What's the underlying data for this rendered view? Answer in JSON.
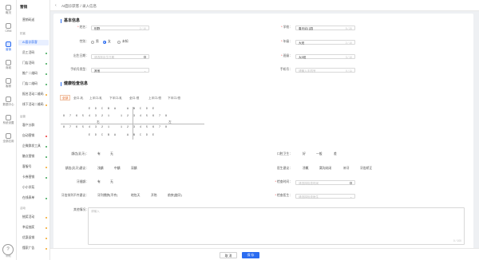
{
  "rail": [
    {
      "label": "概况",
      "icon": "dashboard-icon"
    },
    {
      "label": "CRM",
      "icon": "user-icon"
    },
    {
      "label": "营销",
      "icon": "flower-icon"
    },
    {
      "label": "商城",
      "icon": "store-icon"
    },
    {
      "label": "客服",
      "icon": "headset-icon"
    },
    {
      "label": "数据中心",
      "icon": "data-icon"
    },
    {
      "label": "系统设置",
      "icon": "gear-icon"
    },
    {
      "label": "全部应用",
      "icon": "grid-icon"
    }
  ],
  "help_label": "帮助",
  "menu": {
    "title": "营销",
    "item_top": "营销码送",
    "group_tuoke": "拓客",
    "tuoke_items": [
      {
        "label": "AI面诊获客",
        "dot": ""
      },
      {
        "label": "员工活码",
        "dot": "#3aa655"
      },
      {
        "label": "门店活码",
        "dot": "#3aa655"
      },
      {
        "label": "推广二维码",
        "dot": "#3aa655"
      },
      {
        "label": "门店二维码",
        "dot": "#3aa655"
      },
      {
        "label": "报名活动二维码",
        "dot": "#f5a623"
      },
      {
        "label": "线下活动二维码",
        "dot": "#f5a623"
      }
    ],
    "group_yunying": "运营",
    "yunying_items": [
      {
        "label": "客户分群",
        "dot": ""
      },
      {
        "label": "自动营销",
        "dot": "#e33"
      },
      {
        "label": "企微群发工具",
        "dot": "#3aa655"
      },
      {
        "label": "触点营销",
        "dot": "#3aa655"
      },
      {
        "label": "客服号",
        "dot": "#f5a623"
      },
      {
        "label": "卡券营销",
        "dot": "#3aa655"
      },
      {
        "label": "小小学苑",
        "dot": ""
      },
      {
        "label": "在线表单",
        "dot": "#3aa655"
      }
    ],
    "group_huodong": "活动",
    "huodong_items": [
      {
        "label": "抽奖活动",
        "dot": "#f5a623"
      },
      {
        "label": "幸运抽奖",
        "dot": "#f5a623"
      },
      {
        "label": "优惠促销",
        "dot": "#f5a623"
      },
      {
        "label": "懂家广告",
        "dot": "#f5a623"
      }
    ]
  },
  "topbar": {
    "back": "‹",
    "breadcrumb": "AI面诊获客 / 录入信息"
  },
  "basic": {
    "title": "基本信息",
    "name": {
      "label": "姓名：",
      "value": "别野",
      "count": "2 / 10"
    },
    "gender": {
      "label": "性别：",
      "options": [
        "男",
        "女",
        "未知"
      ],
      "selected": 1
    },
    "birth": {
      "label": "出生日期：",
      "placeholder": "请选择出生日期"
    },
    "phone_type": {
      "label": "手机号类型：",
      "value": "其他"
    },
    "school": {
      "label": "学校：",
      "value": "春天幼儿园",
      "count": "5 / 20"
    },
    "grade": {
      "label": "年级：",
      "value": "大班",
      "count": "2 / 10"
    },
    "class": {
      "label": "班级：",
      "value": "大5班",
      "count": "3 / 10"
    },
    "phone": {
      "label": "手机号：",
      "placeholder": "请输入手机号",
      "count": "0 / 11"
    }
  },
  "check": {
    "title": "健康检查信息",
    "tabs": [
      "全部",
      "全口-乳",
      "上半口-乳",
      "下半口-乳",
      "全口-恒",
      "上半口-恒",
      "下半口-恒"
    ],
    "active_tab": 0,
    "grid": {
      "row1_left": [
        "",
        "",
        "",
        "",
        "E",
        "D",
        "C",
        "B",
        "A"
      ],
      "row1_right": [
        "A",
        "B",
        "C",
        "D",
        "E",
        "",
        "",
        "",
        ""
      ],
      "row2_left": [
        "8",
        "7",
        "6",
        "5",
        "4",
        "3",
        "2",
        "1"
      ],
      "row2_right": [
        "1",
        "2",
        "3",
        "4",
        "5",
        "6",
        "7",
        "8"
      ],
      "mid_left": "右",
      "mid_right": "左",
      "row3_left": [
        "8",
        "7",
        "6",
        "5",
        "4",
        "3",
        "2",
        "1"
      ],
      "row3_right": [
        "1",
        "2",
        "3",
        "4",
        "5",
        "6",
        "7",
        "8"
      ],
      "row4_left": [
        "",
        "",
        "",
        "",
        "E",
        "D",
        "C",
        "B",
        "A"
      ],
      "row4_right": [
        "A",
        "B",
        "C",
        "D",
        "E",
        "",
        "",
        "",
        ""
      ]
    },
    "caries": {
      "label": "龋齿(乳牙)：",
      "options": [
        "有",
        "无"
      ]
    },
    "caries_advice": {
      "label": "龋齿(乳牙)建议：",
      "options": [
        "浅龋",
        "中龋",
        "深龋"
      ]
    },
    "gap": {
      "label": "牙缝龋：",
      "options": [
        "有",
        "无"
      ]
    },
    "misalign": {
      "label": "牙齿排列不齐建议：",
      "options": [
        "牙列拥挤(不齐)",
        "地包天",
        "开殆",
        "前突(龅牙)"
      ]
    },
    "hygiene": {
      "label": "口腔卫生：",
      "options": [
        "好",
        "一般",
        "差"
      ]
    },
    "doctor_advice": {
      "label": "医生建议：",
      "options": [
        "涂氟",
        "窝沟封闭",
        "补牙",
        "牙齿矫正"
      ]
    },
    "check_time": {
      "label": "检查时间：",
      "placeholder": "请选择检查时间"
    },
    "check_doctor": {
      "label": "检查医生：",
      "placeholder": "请选择检查医生"
    },
    "other": {
      "label": "其他情况：",
      "placeholder": "请输入",
      "count": "0 / 100"
    }
  },
  "footer": {
    "cancel": "取 消",
    "save": "保 存"
  }
}
